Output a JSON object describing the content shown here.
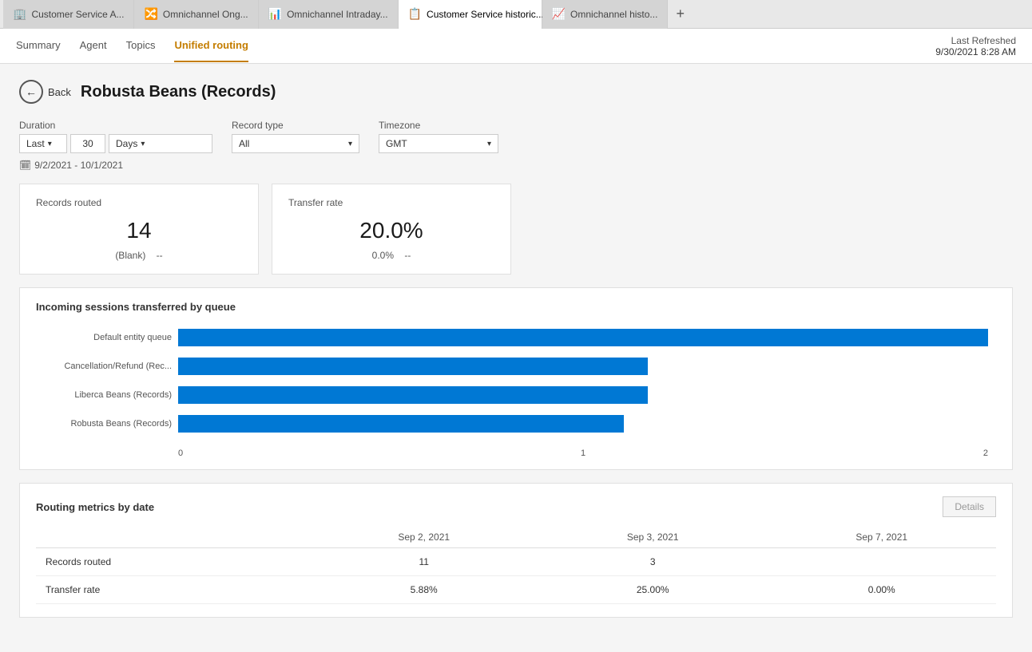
{
  "tabs": [
    {
      "id": "tab1",
      "icon": "🏢",
      "label": "Customer Service A...",
      "active": false,
      "closable": false
    },
    {
      "id": "tab2",
      "icon": "🔀",
      "label": "Omnichannel Ong...",
      "active": false,
      "closable": false
    },
    {
      "id": "tab3",
      "icon": "📊",
      "label": "Omnichannel Intraday...",
      "active": false,
      "closable": false
    },
    {
      "id": "tab4",
      "icon": "📋",
      "label": "Customer Service historic...",
      "active": true,
      "closable": true
    },
    {
      "id": "tab5",
      "icon": "📈",
      "label": "Omnichannel histo...",
      "active": false,
      "closable": false
    }
  ],
  "nav": {
    "items": [
      {
        "id": "summary",
        "label": "Summary",
        "active": false
      },
      {
        "id": "agent",
        "label": "Agent",
        "active": false
      },
      {
        "id": "topics",
        "label": "Topics",
        "active": false
      },
      {
        "id": "unified-routing",
        "label": "Unified routing",
        "active": true
      }
    ],
    "last_refreshed_label": "Last Refreshed",
    "last_refreshed_time": "9/30/2021 8:28 AM"
  },
  "page": {
    "back_label": "Back",
    "title": "Robusta Beans (Records)"
  },
  "filters": {
    "duration_label": "Duration",
    "duration_prefix": "Last",
    "duration_value": "30",
    "duration_unit": "Days",
    "record_type_label": "Record type",
    "record_type_value": "All",
    "timezone_label": "Timezone",
    "timezone_value": "GMT",
    "date_range": "9/2/2021 - 10/1/2021"
  },
  "kpis": {
    "records_routed": {
      "title": "Records routed",
      "value": "14",
      "sub_label": "(Blank)",
      "sub_value": "--"
    },
    "transfer_rate": {
      "title": "Transfer rate",
      "value": "20.0%",
      "sub_label": "0.0%",
      "sub_value": "--"
    }
  },
  "chart": {
    "title": "Incoming sessions transferred by queue",
    "bars": [
      {
        "label": "Default entity queue",
        "width_pct": 100
      },
      {
        "label": "Cancellation/Refund (Rec...",
        "width_pct": 58
      },
      {
        "label": "Liberca Beans (Records)",
        "width_pct": 58
      },
      {
        "label": "Robusta Beans (Records)",
        "width_pct": 55
      }
    ],
    "x_labels": [
      "0",
      "1",
      "2"
    ]
  },
  "routing_table": {
    "title": "Routing metrics by date",
    "details_btn": "Details",
    "columns": [
      "",
      "Sep 2, 2021",
      "Sep 3, 2021",
      "Sep 7, 2021"
    ],
    "rows": [
      {
        "metric": "Records routed",
        "values": [
          "11",
          "3",
          ""
        ]
      },
      {
        "metric": "Transfer rate",
        "values": [
          "5.88%",
          "25.00%",
          "0.00%"
        ]
      }
    ]
  }
}
